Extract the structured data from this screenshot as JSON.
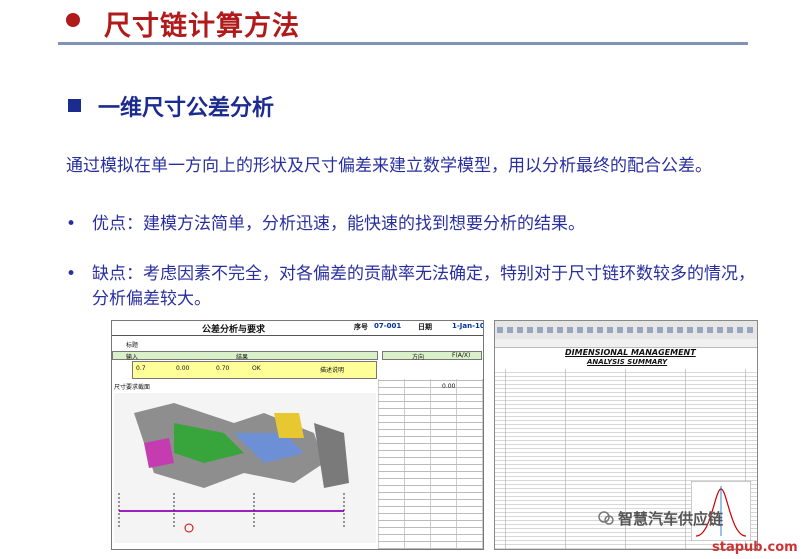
{
  "slide": {
    "title": "尺寸链计算方法",
    "section_title": "一维尺寸公差分析",
    "paragraph": "通过模拟在单一方向上的形状及尺寸偏差来建立数学模型，用以分析最终的配合公差。",
    "bullets": [
      {
        "marker": "•",
        "text": "优点：建模方法简单，分析迅速，能快速的找到想要分析的结果。"
      },
      {
        "marker": "•",
        "text": "缺点：考虑因素不完全，对各偏差的贡献率无法确定，特别对于尺寸链环数较多的情况，分析偏差较大。"
      }
    ],
    "colors": {
      "title": "#b11a1a",
      "body": "#2a2fa0",
      "section": "#1c2b8f",
      "rule": "#7f93b5"
    }
  },
  "left_sheet": {
    "title": "公差分析与要求",
    "serial_label": "序号",
    "serial_value": "07-001",
    "date_label": "日期",
    "date_value": "1-Jan-10",
    "labels": [
      "标题",
      "输入",
      "结果",
      "方向",
      "F(A/X)",
      "尺寸要求截面",
      "描述说明"
    ],
    "values": [
      "0.7",
      "0.00",
      "0.70",
      "OK",
      "0.00"
    ]
  },
  "right_sheet": {
    "title": "DIMENSIONAL MANAGEMENT",
    "subtitle": "ANALYSIS SUMMARY"
  },
  "watermark": {
    "text": "智慧汽车供应链",
    "site": "stapub.com"
  }
}
